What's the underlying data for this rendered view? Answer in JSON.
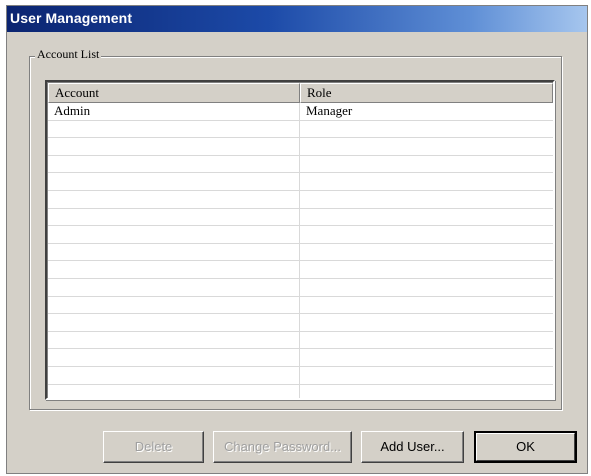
{
  "window": {
    "title": "User Management"
  },
  "account_list": {
    "group_label": "Account List",
    "columns": [
      {
        "label": "Account"
      },
      {
        "label": "Role"
      }
    ],
    "rows": [
      {
        "account": "Admin",
        "role": "Manager"
      },
      {
        "account": "",
        "role": ""
      },
      {
        "account": "",
        "role": ""
      },
      {
        "account": "",
        "role": ""
      },
      {
        "account": "",
        "role": ""
      },
      {
        "account": "",
        "role": ""
      },
      {
        "account": "",
        "role": ""
      },
      {
        "account": "",
        "role": ""
      },
      {
        "account": "",
        "role": ""
      },
      {
        "account": "",
        "role": ""
      },
      {
        "account": "",
        "role": ""
      },
      {
        "account": "",
        "role": ""
      },
      {
        "account": "",
        "role": ""
      },
      {
        "account": "",
        "role": ""
      },
      {
        "account": "",
        "role": ""
      },
      {
        "account": "",
        "role": ""
      },
      {
        "account": "",
        "role": ""
      }
    ]
  },
  "buttons": {
    "delete_label": "Delete",
    "delete_enabled": false,
    "change_password_label": "Change Password...",
    "change_password_enabled": false,
    "add_user_label": "Add User...",
    "ok_label": "OK"
  },
  "colors": {
    "titlebar_start": "#0b2470",
    "titlebar_end": "#a6c6ee",
    "dialog_background": "#d4d0c8",
    "list_background": "#ffffff",
    "disabled_text": "#a0a0a0"
  }
}
